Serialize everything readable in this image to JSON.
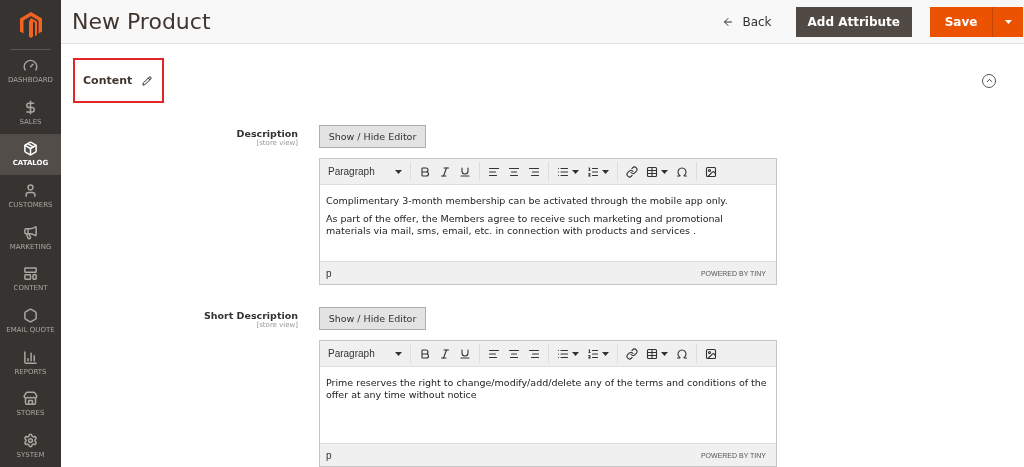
{
  "sidebar": {
    "items": [
      {
        "label": "DASHBOARD",
        "selected": false
      },
      {
        "label": "SALES",
        "selected": false
      },
      {
        "label": "CATALOG",
        "selected": true
      },
      {
        "label": "CUSTOMERS",
        "selected": false
      },
      {
        "label": "MARKETING",
        "selected": false
      },
      {
        "label": "CONTENT",
        "selected": false
      },
      {
        "label": "EMAIL QUOTE",
        "selected": false
      },
      {
        "label": "REPORTS",
        "selected": false
      },
      {
        "label": "STORES",
        "selected": false
      },
      {
        "label": "SYSTEM",
        "selected": false
      }
    ]
  },
  "header": {
    "title": "New Product",
    "back": "Back",
    "add_attribute": "Add Attribute",
    "save": "Save"
  },
  "section": {
    "title": "Content",
    "expanded": true
  },
  "fields": [
    {
      "label": "Description",
      "scope": "[store view]",
      "toggle": "Show / Hide Editor",
      "format": "Paragraph",
      "paragraphs": [
        "Complimentary 3-month membership can be activated through the mobile app only.",
        "As part of the offer, the Members agree to receive such marketing and promotional materials via mail, sms, email, etc. in connection with products and services ."
      ],
      "path": "p",
      "branding": "POWERED BY TINY"
    },
    {
      "label": "Short Description",
      "scope": "[store view]",
      "toggle": "Show / Hide Editor",
      "format": "Paragraph",
      "paragraphs": [
        "Prime reserves the right to change/modify/add/delete any of the terms and conditions of the offer at any time without notice"
      ],
      "path": "p",
      "branding": "POWERED BY TINY"
    }
  ]
}
